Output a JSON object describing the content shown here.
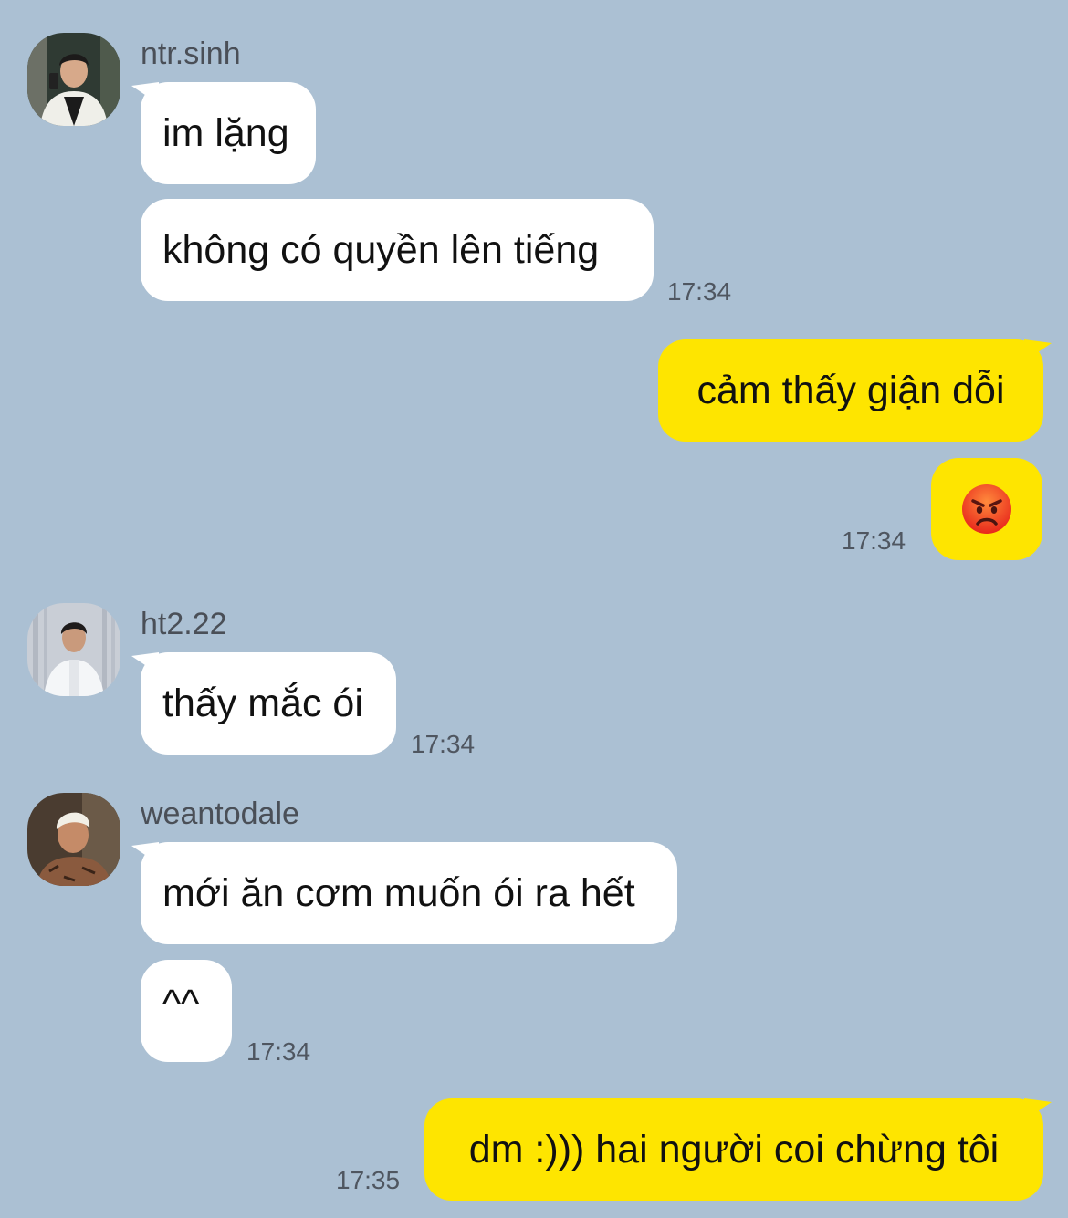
{
  "colors": {
    "background": "#abc0d3",
    "incoming_bubble": "#ffffff",
    "outgoing_bubble": "#fee500",
    "timestamp": "#4f5660",
    "sender_name": "#4a4f57"
  },
  "messages": [
    {
      "sender": "ntr.sinh",
      "direction": "in",
      "avatar": "avatar-ntr-sinh",
      "bubbles": [
        "im lặng",
        "không có quyền lên tiếng"
      ],
      "time": "17:34"
    },
    {
      "sender": "me",
      "direction": "out",
      "bubbles": [
        "cảm thấy giận dỗi"
      ]
    },
    {
      "sender": "me",
      "direction": "out",
      "emoji": "angry-face-icon",
      "time": "17:34"
    },
    {
      "sender": "ht2.22",
      "direction": "in",
      "avatar": "avatar-ht2-22",
      "bubbles": [
        "thấy mắc ói"
      ],
      "time": "17:34"
    },
    {
      "sender": "weantodale",
      "direction": "in",
      "avatar": "avatar-weantodale",
      "bubbles": [
        "mới ăn cơm muốn ói ra hết",
        "^^"
      ],
      "time": "17:34"
    },
    {
      "sender": "me",
      "direction": "out",
      "bubbles": [
        "dm :))) hai người coi chừng tôi"
      ],
      "time": "17:35"
    }
  ]
}
